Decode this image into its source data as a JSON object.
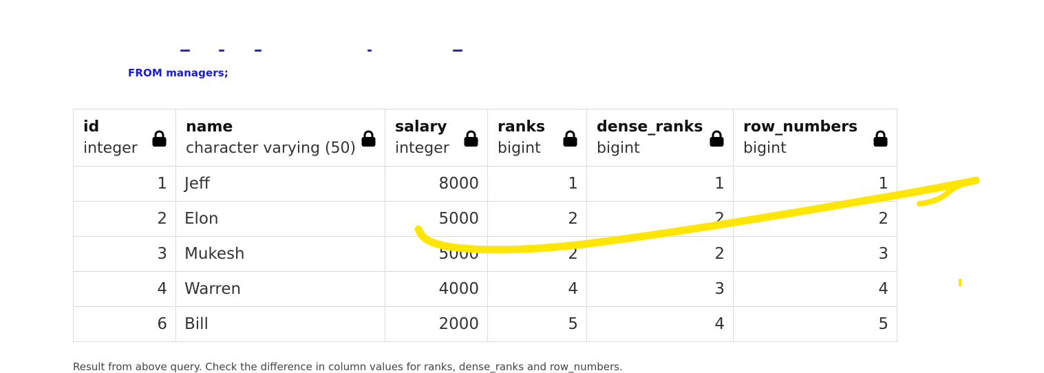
{
  "query": {
    "line": "FROM managers;"
  },
  "table": {
    "columns": [
      {
        "name": "id",
        "type": "integer",
        "align": "num"
      },
      {
        "name": "name",
        "type": "character varying (50)",
        "align": "txt"
      },
      {
        "name": "salary",
        "type": "integer",
        "align": "num"
      },
      {
        "name": "ranks",
        "type": "bigint",
        "align": "num"
      },
      {
        "name": "dense_ranks",
        "type": "bigint",
        "align": "num"
      },
      {
        "name": "row_numbers",
        "type": "bigint",
        "align": "num"
      }
    ],
    "rows": [
      [
        "1",
        "Jeff",
        "8000",
        "1",
        "1",
        "1"
      ],
      [
        "2",
        "Elon",
        "5000",
        "2",
        "2",
        "2"
      ],
      [
        "3",
        "Mukesh",
        "5000",
        "2",
        "2",
        "3"
      ],
      [
        "4",
        "Warren",
        "4000",
        "4",
        "3",
        "4"
      ],
      [
        "6",
        "Bill",
        "2000",
        "5",
        "4",
        "5"
      ]
    ]
  },
  "caption": "Result from above query. Check the difference in column values for ranks, dense_ranks and row_numbers.",
  "colors": {
    "query_text": "#1a1ad0",
    "highlight": "#ffe600",
    "grid": "#d9d9d9"
  },
  "icons": {
    "column_lock": "lock-icon"
  }
}
